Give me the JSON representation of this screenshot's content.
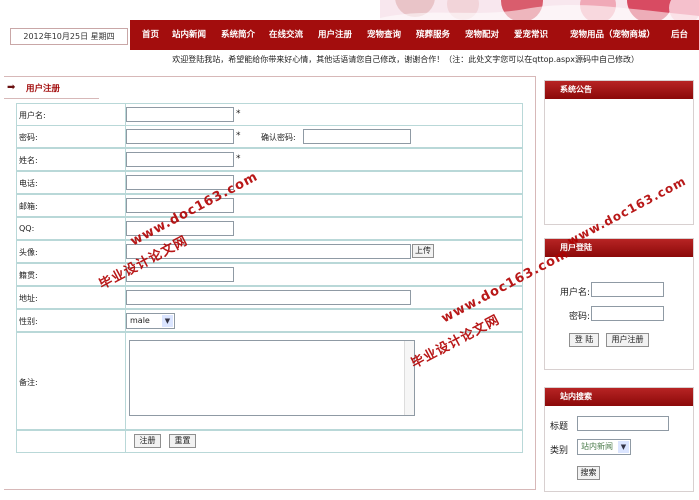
{
  "header": {
    "date": "2012年10月25日 星期四",
    "nav": [
      "首页",
      "站内新闻",
      "系统简介",
      "在线交流",
      "用户注册",
      "宠物查询",
      "殡葬服务",
      "宠物配对",
      "爱宠常识",
      "宠物用品（宠物商城）",
      "后台"
    ]
  },
  "welcome": "欢迎登陆我站，希望能给你带来好心情，其他话语请您自己修改，谢谢合作！（注：此处文字您可以在qttop.aspx源码中自己修改）",
  "main": {
    "title": "用户注册",
    "fields": {
      "username": "用户名:",
      "password": "密码:",
      "confirm_password": "确认密码:",
      "name": "姓名:",
      "phone": "电话:",
      "email": "邮箱:",
      "qq": "QQ:",
      "avatar": "头像:",
      "native_place": "籍贯:",
      "address": "地址:",
      "gender": "性别:",
      "remark": "备注:"
    },
    "required_mark": "*",
    "upload_label": "上传",
    "gender_value": "male",
    "register_label": "注册",
    "reset_label": "重置"
  },
  "sidebar": {
    "notice_title": "系统公告",
    "login_title": "用户登陆",
    "login_username": "用户名:",
    "login_password": "密码:",
    "login_button": "登 陆",
    "register_button": "用户注册",
    "search_title": "站内搜索",
    "search_title_label": "标题",
    "search_type_label": "类别",
    "search_type_value": "站内新闻",
    "search_button": "搜索"
  },
  "watermarks": [
    "毕业设计论文网",
    "www.doc163.com",
    "毕业设计论文网",
    "www.doc163.com",
    "www.doc163.com"
  ]
}
